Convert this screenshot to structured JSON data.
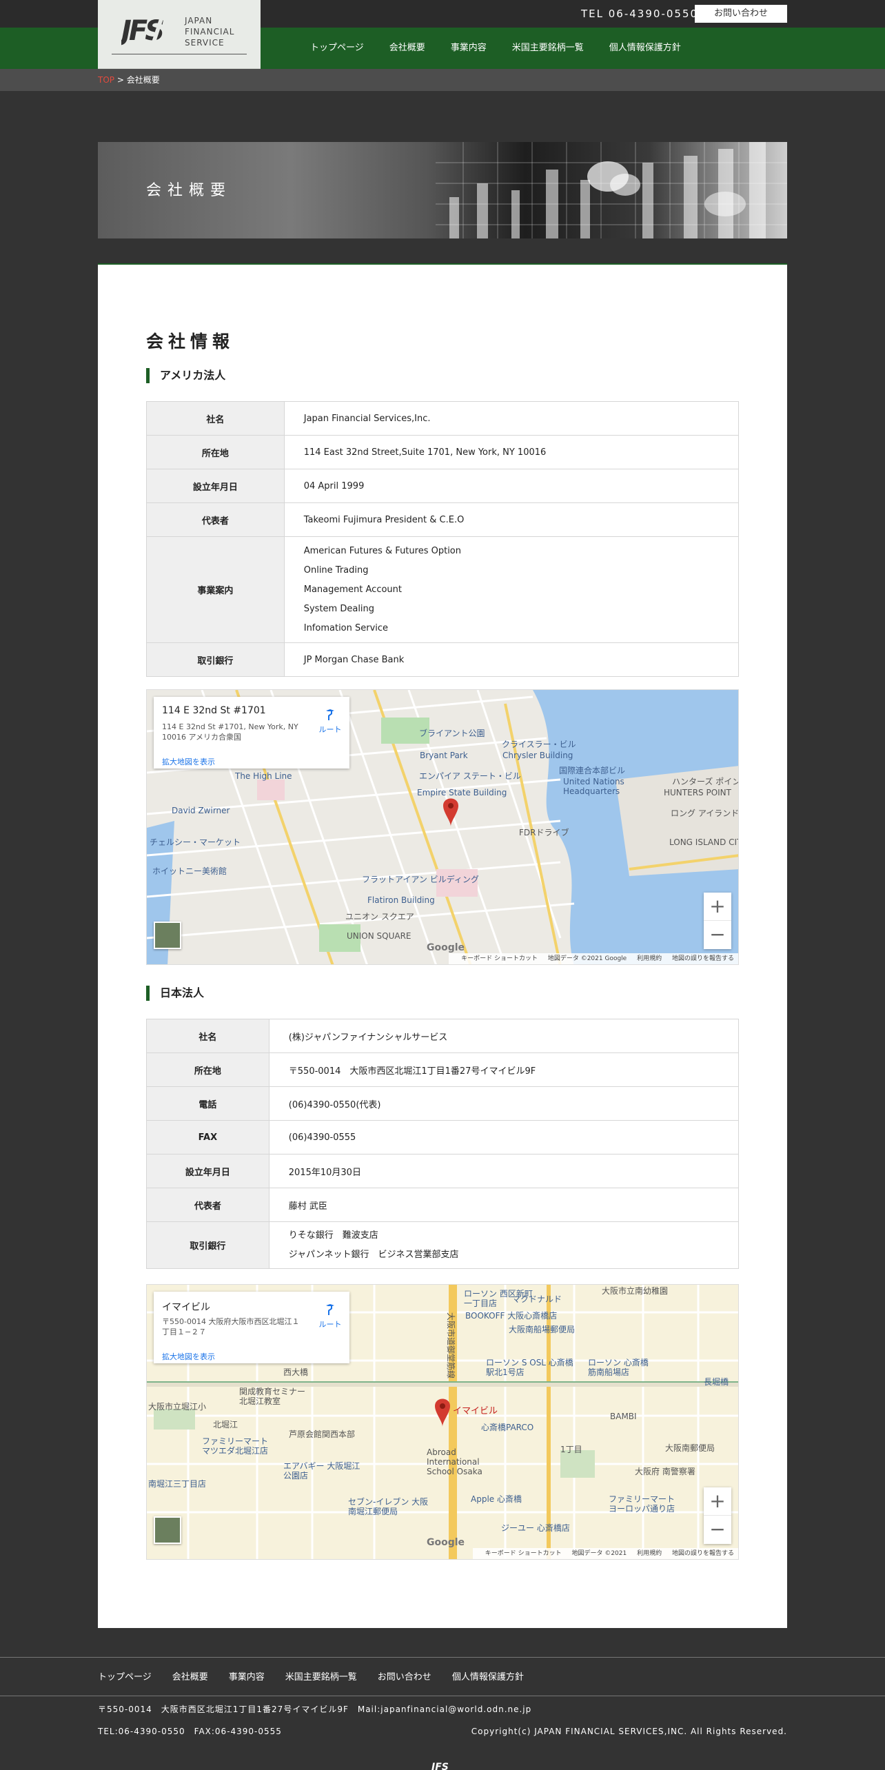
{
  "header": {
    "tel": "TEL 06-4390-0550",
    "contact_label": "お問い合わせ",
    "logo": {
      "mark": "JFS",
      "text": "JAPAN\nFINANCIAL\nSERVICE"
    },
    "nav": [
      "トップページ",
      "会社概要",
      "事業内容",
      "米国主要銘柄一覧",
      "個人情報保護方針"
    ]
  },
  "breadcrumb": {
    "top": "TOP",
    "separator": " > ",
    "current": "会社概要"
  },
  "hero": {
    "title": "会社概要"
  },
  "content": {
    "title": "会社情報",
    "us": {
      "heading": "アメリカ法人",
      "rows": [
        {
          "label": "社名",
          "values": [
            "Japan Financial Services,Inc."
          ]
        },
        {
          "label": "所在地",
          "values": [
            "114 East 32nd Street,Suite 1701, New York, NY 10016"
          ]
        },
        {
          "label": "設立年月日",
          "values": [
            "04 April 1999"
          ]
        },
        {
          "label": "代表者",
          "values": [
            "Takeomi Fujimura President & C.E.O"
          ]
        },
        {
          "label": "事業案内",
          "values": [
            "American Futures & Futures Option",
            "Online Trading",
            "Management Account",
            "System Dealing",
            "Infomation Service"
          ]
        },
        {
          "label": "取引銀行",
          "values": [
            "JP Morgan Chase Bank"
          ]
        }
      ],
      "map": {
        "title": "114 E 32nd St #1701",
        "address": "114 E 32nd St #1701, New York, NY 10016 アメリカ合衆国",
        "link": "拡大地図を表示",
        "route": "ルート",
        "labels": [
          "ブライアント公園",
          "クライスラー・ビル",
          "エンパイア ステート・ビル",
          "国際連合本部ビル",
          "ハンターズ ポイント",
          "HUNTERS POINT",
          "ロング アイランド シティ",
          "LONG ISLAND CITY",
          "David Zwirner",
          "The High Line",
          "チェルシー・マーケット",
          "ホイットニー美術館",
          "フラットアイアン ビルディング",
          "Flatiron Building",
          "ユニオン スクエア",
          "UNION SQUARE",
          "Empire State Building",
          "Chrysler Building",
          "United Nations Headquarters",
          "Bryant Park",
          "FDRドライブ"
        ],
        "attribution": {
          "shortcuts": "キーボード ショートカット",
          "data": "地図データ ©2021 Google",
          "terms": "利用規約",
          "report": "地図の誤りを報告する"
        }
      }
    },
    "jp": {
      "heading": "日本法人",
      "rows": [
        {
          "label": "社名",
          "values": [
            "(株)ジャパンファイナンシャルサービス"
          ]
        },
        {
          "label": "所在地",
          "values": [
            "〒550-0014　大阪市西区北堀江1丁目1番27号イマイビル9F"
          ]
        },
        {
          "label": "電話",
          "values": [
            "(06)4390-0550(代表)"
          ]
        },
        {
          "label": "FAX",
          "values": [
            "(06)4390-0555"
          ]
        },
        {
          "label": "設立年月日",
          "values": [
            "2015年10月30日"
          ]
        },
        {
          "label": "代表者",
          "values": [
            "藤村 武臣"
          ]
        },
        {
          "label": "取引銀行",
          "values": [
            "りそな銀行　難波支店",
            "ジャパンネット銀行　ビジネス営業部支店"
          ]
        }
      ],
      "map": {
        "title": "イマイビル",
        "address": "〒550-0014 大阪府大阪市西区北堀江１丁目１−２７",
        "link": "拡大地図を表示",
        "route": "ルート",
        "pin": "イマイビル",
        "labels": [
          "ローソン 西区新町一丁目店",
          "マクドナルド",
          "大阪市立南幼稚園",
          "BOOKOFF 大阪心斎橋店",
          "大阪南船場郵便局",
          "ローソン S OSL 心斎橋駅北1号店",
          "ローソン 心斎橋筋南船場店",
          "大阪市立堀江小",
          "関成教育セミナー 北堀江教室",
          "芦原会館関西本部",
          "BAMBI",
          "長堀橋",
          "ファミリーマート マツエダ北堀江店",
          "エアバギー 大阪堀江公園店",
          "Abroad International School Osaka",
          "心斎橋PARCO",
          "大阪南郵便局",
          "大阪府 南警察署",
          "Apple 心斎橋",
          "セブン-イレブン 大阪南堀江郵便局",
          "ファミリーマート ヨーロッパ通り店",
          "ジーユー 心斎橋店",
          "大阪市道御堂筋線",
          "南堀江三丁目店",
          "西大橋",
          "北堀江",
          "1丁目"
        ],
        "attribution": {
          "shortcuts": "キーボード ショートカット",
          "data": "地図データ ©2021",
          "terms": "利用規約",
          "report": "地図の誤りを報告する"
        }
      }
    }
  },
  "footer": {
    "nav": [
      "トップページ",
      "会社概要",
      "事業内容",
      "米国主要銘柄一覧",
      "お問い合わせ",
      "個人情報保護方針"
    ],
    "address": "〒550-0014　大阪市西区北堀江1丁目1番27号イマイビル9F　Mail:japanfinancial@world.odn.ne.jp",
    "telfax": "TEL:06-4390-0550　FAX:06-4390-0555",
    "copyright": "Copyright(c) JAPAN FINANCIAL SERVICES,INC. All Rights Reserved."
  },
  "colors": {
    "brand_green": "#1d5e25",
    "dark_bg": "#333333",
    "breadcrumb_link": "#e34a3d",
    "map_link": "#1a73e8"
  }
}
